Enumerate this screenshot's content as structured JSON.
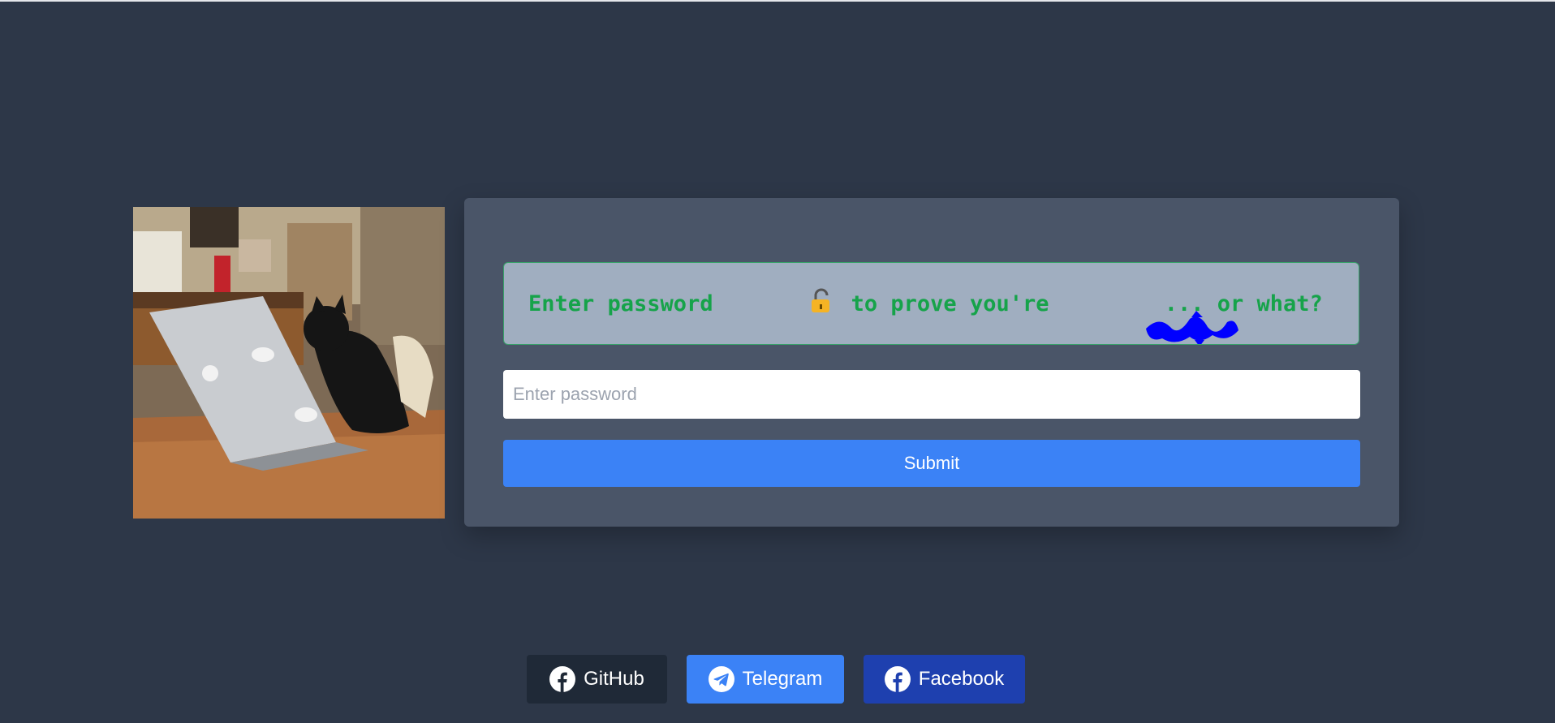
{
  "image": {
    "alt": "Cat typing on a laptop"
  },
  "prompt": {
    "before_icon": "Enter password ",
    "middle": " to prove yo",
    "middle2": "u're ",
    "after_redaction": "... or what? ",
    "lock_icon": "lock-icon",
    "eyes_icon": "eyes-icon",
    "detective_icon": "detective-icon",
    "text_color": "#16a34a",
    "box_color": "#a0aec0"
  },
  "form": {
    "password_placeholder": "Enter password",
    "password_value": "",
    "submit_label": "Submit",
    "submit_color": "#3b82f6"
  },
  "social": {
    "github_label": "GitHub",
    "telegram_label": "Telegram",
    "facebook_label": "Facebook"
  },
  "colors": {
    "background": "#2d3748",
    "card": "#4a5568",
    "redaction": "#0000ff"
  }
}
